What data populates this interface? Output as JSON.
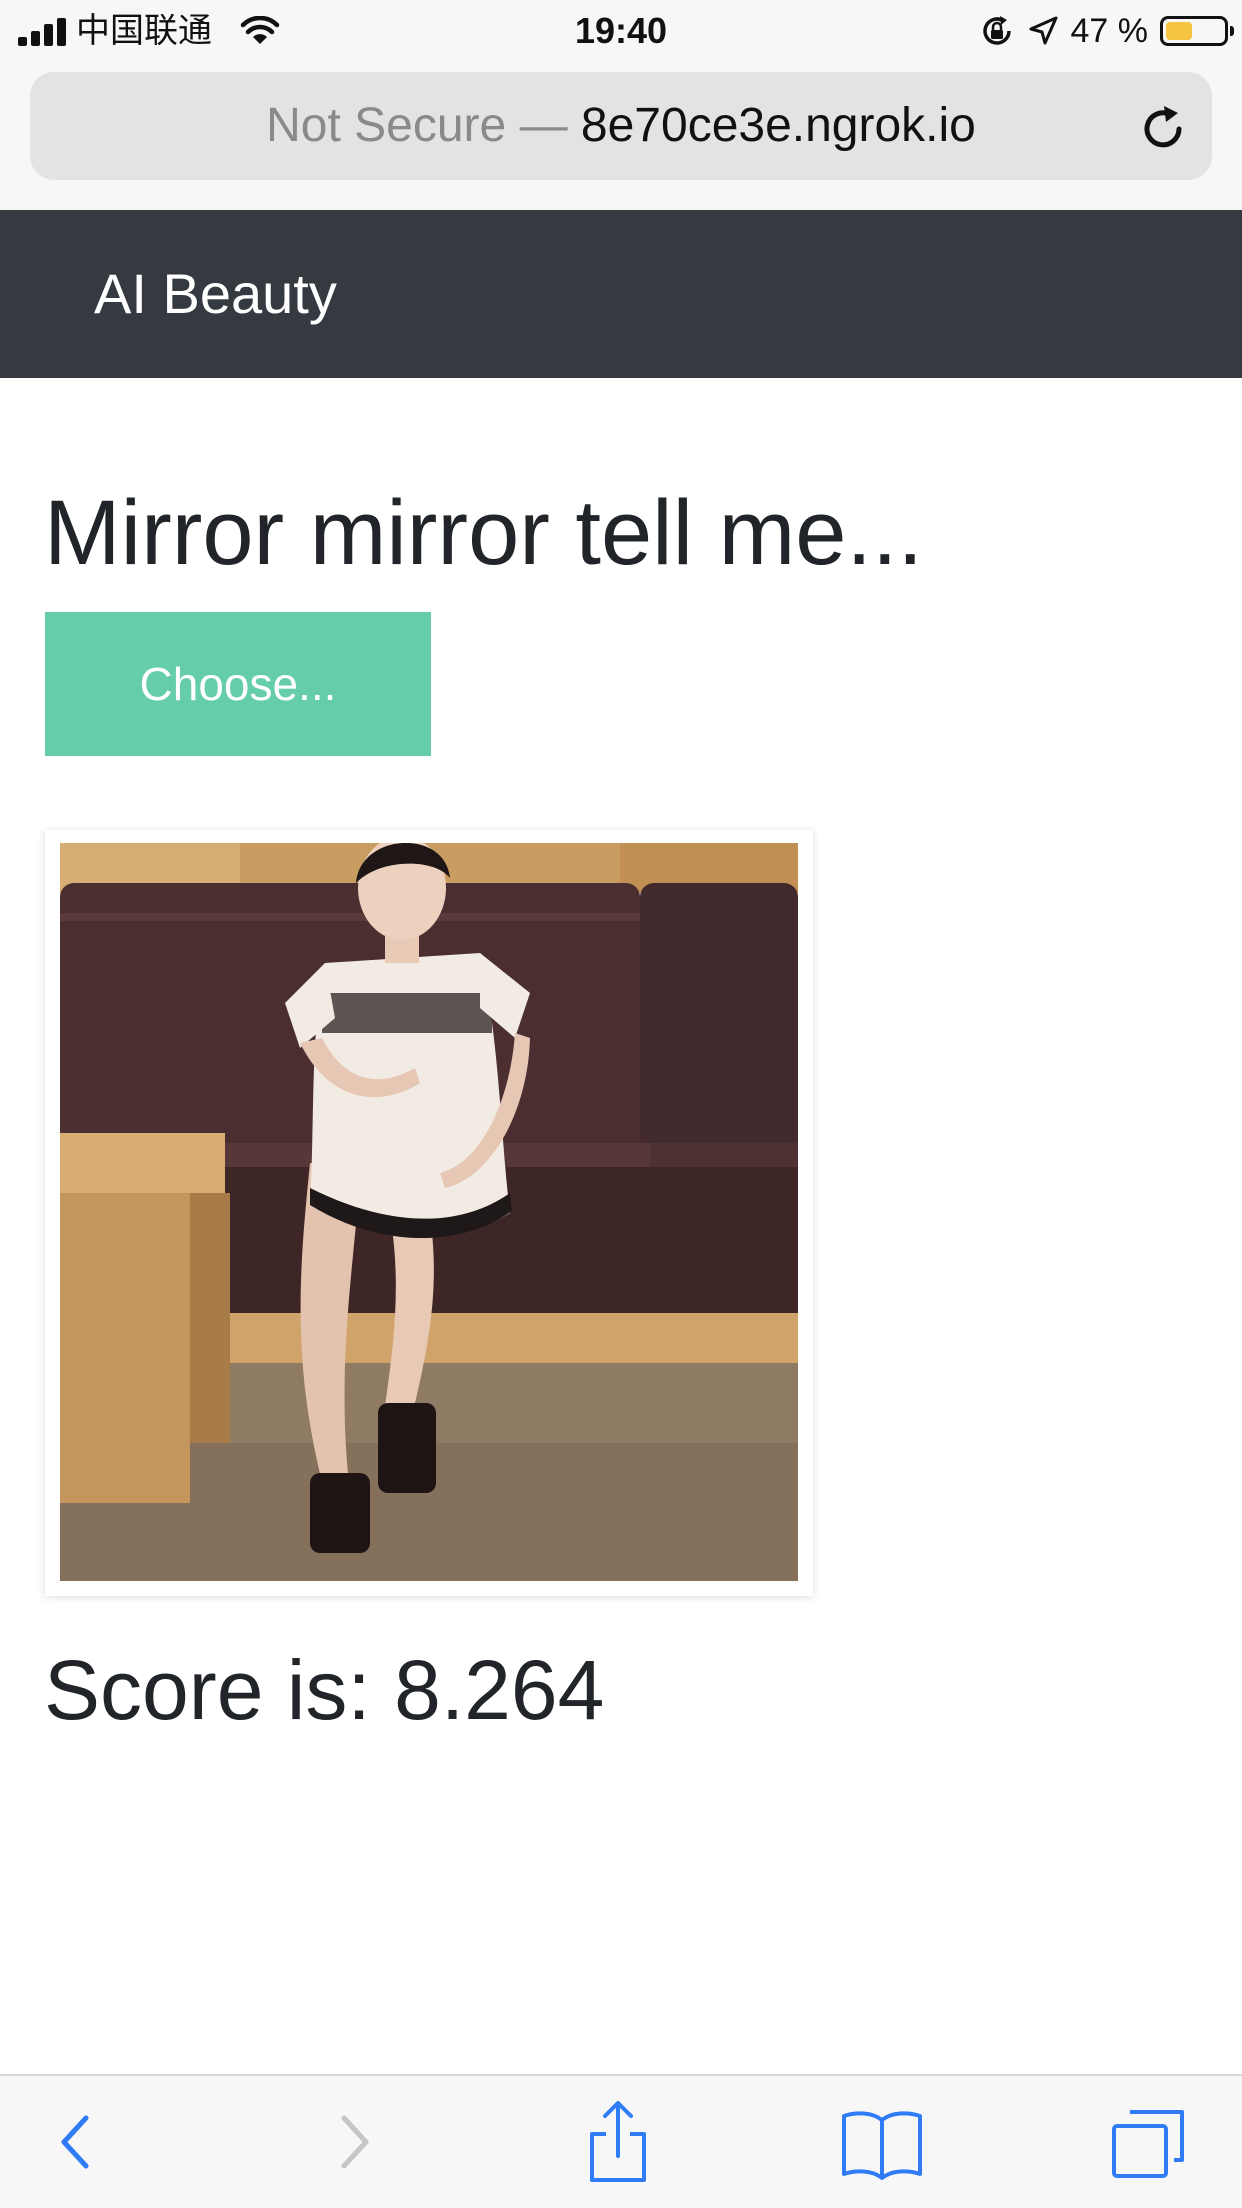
{
  "status_bar": {
    "carrier": "中国联通",
    "time": "19:40",
    "battery_percent": "47 %",
    "battery_level": 0.47,
    "icons": [
      "signal-icon",
      "wifi-icon",
      "orientation-lock-icon",
      "location-arrow-icon",
      "battery-icon"
    ]
  },
  "browser": {
    "security_label": "Not Secure —",
    "host": "8e70ce3e.ngrok.io",
    "reload_icon": "reload-icon",
    "toolbar_icons": [
      "back-icon",
      "forward-icon",
      "share-icon",
      "bookmarks-icon",
      "tabs-icon"
    ]
  },
  "navbar": {
    "brand": "AI Beauty"
  },
  "main": {
    "heading": "Mirror mirror tell me...",
    "choose_button_label": "Choose...",
    "score_text": "Score is: 8.264"
  },
  "colors": {
    "navbar_bg": "#343a40",
    "button_bg": "#66cdaa",
    "ios_link_blue": "#2f7cf6",
    "battery_fill": "#f5c542"
  }
}
